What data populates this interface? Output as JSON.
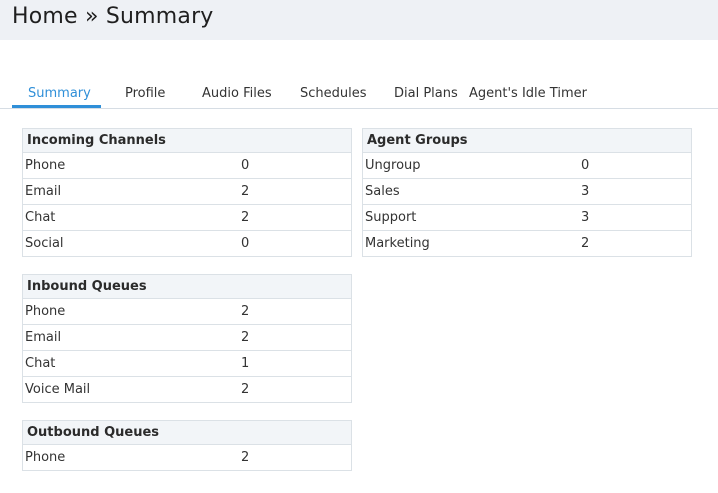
{
  "header": {
    "title": "Home » Summary"
  },
  "tabs": [
    {
      "label": "Summary"
    },
    {
      "label": "Profile"
    },
    {
      "label": "Audio Files"
    },
    {
      "label": "Schedules"
    },
    {
      "label": "Dial Plans"
    },
    {
      "label": "Agent's Idle Timer"
    }
  ],
  "active_tab": "Summary",
  "colors": {
    "accent": "#2f8fd8",
    "header_bg": "#eef1f5",
    "panel_header_bg": "#f2f5f8",
    "border": "#dbe1e6"
  },
  "incoming_channels": {
    "title": "Incoming Channels",
    "rows": [
      {
        "label": "Phone",
        "value": "0"
      },
      {
        "label": "Email",
        "value": "2"
      },
      {
        "label": "Chat",
        "value": "2"
      },
      {
        "label": "Social",
        "value": "0"
      }
    ]
  },
  "agent_groups": {
    "title": "Agent Groups",
    "rows": [
      {
        "label": "Ungroup",
        "value": "0"
      },
      {
        "label": "Sales",
        "value": "3"
      },
      {
        "label": "Support",
        "value": "3"
      },
      {
        "label": "Marketing",
        "value": "2"
      }
    ]
  },
  "inbound_queues": {
    "title": "Inbound Queues",
    "rows": [
      {
        "label": "Phone",
        "value": "2"
      },
      {
        "label": "Email",
        "value": "2"
      },
      {
        "label": "Chat",
        "value": "1"
      },
      {
        "label": "Voice Mail",
        "value": "2"
      }
    ]
  },
  "outbound_queues": {
    "title": "Outbound Queues",
    "rows": [
      {
        "label": "Phone",
        "value": "2"
      }
    ]
  }
}
